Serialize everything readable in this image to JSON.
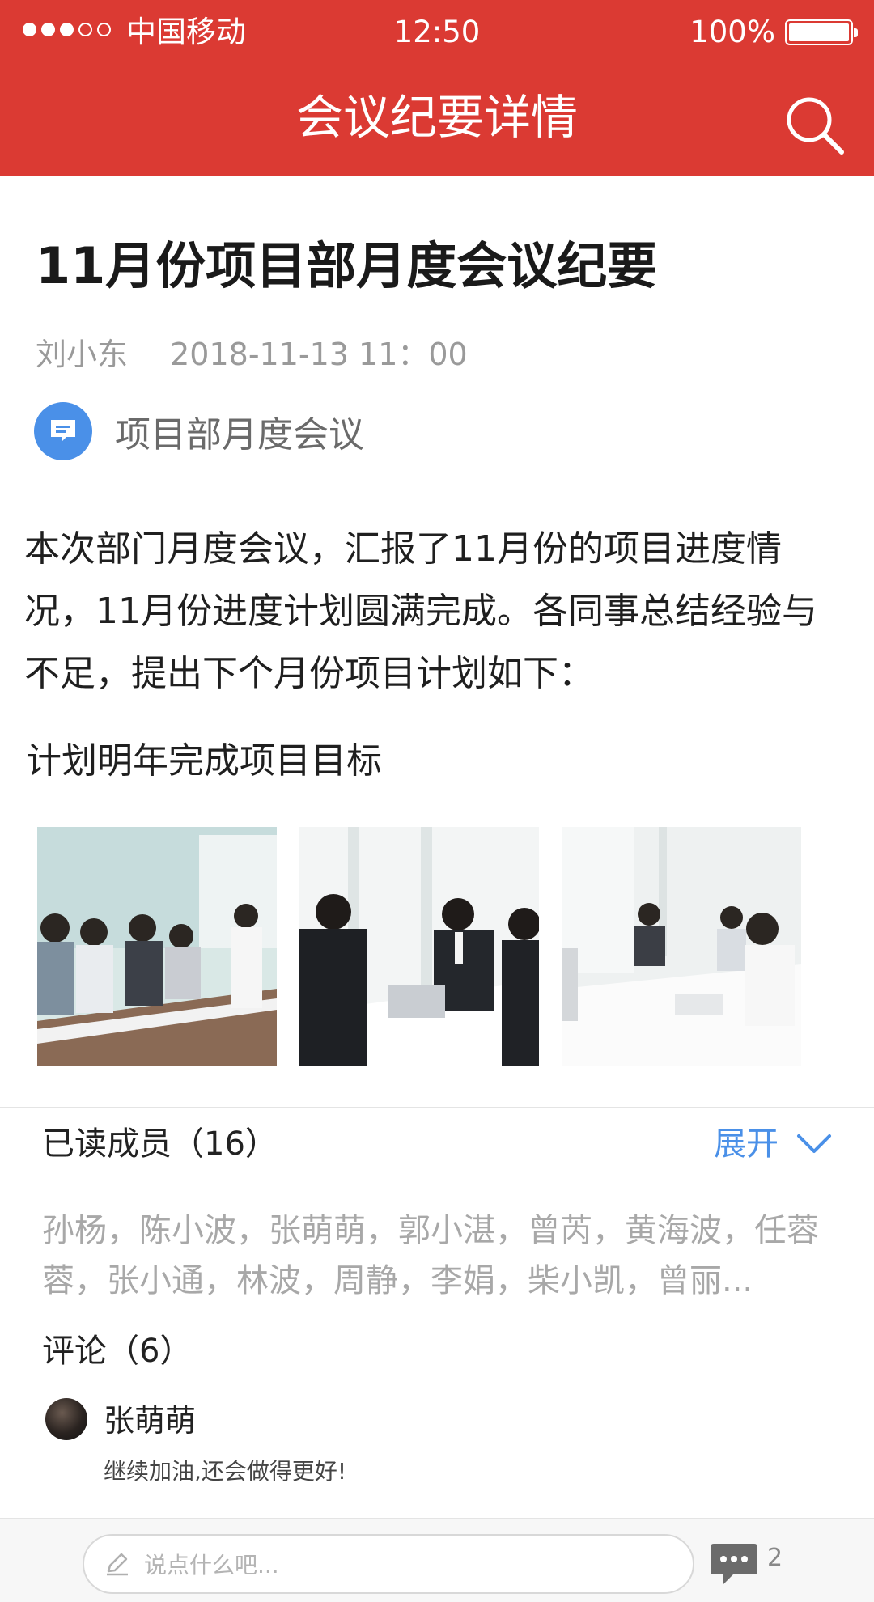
{
  "status_bar": {
    "carrier": "中国移动",
    "time": "12:50",
    "battery": "100%"
  },
  "nav": {
    "title": "会议纪要详情",
    "search_icon": "search-icon"
  },
  "article": {
    "title": "11月份项目部月度会议纪要",
    "author": "刘小东",
    "datetime": "2018-11-13 11：00",
    "category": "项目部月度会议",
    "category_icon": "message-icon",
    "body": "本次部门月度会议，汇报了11月份的项目进度情况，11月份进度计划圆满完成。各同事总结经验与不足，提出下个月份项目计划如下：",
    "subtext": "计划明年完成项目目标",
    "photos": [
      "meeting-photo-1",
      "meeting-photo-2",
      "meeting-photo-3"
    ]
  },
  "read": {
    "label": "已读成员（16）",
    "expand_label": "展开",
    "members": "孙杨，陈小波，张萌萌，郭小湛，曾芮，黄海波，任蓉蓉，张小通，林波，周静，李娟，柴小凯，曾丽..."
  },
  "comments": {
    "label": "评论（6）",
    "items": [
      {
        "name": "张萌萌",
        "text": "继续加油,还会做得更好!"
      }
    ]
  },
  "bottom": {
    "input_placeholder": "说点什么吧...",
    "comment_count": "2"
  },
  "colors": {
    "header": "#db3a33",
    "accent": "#4a90e8"
  }
}
